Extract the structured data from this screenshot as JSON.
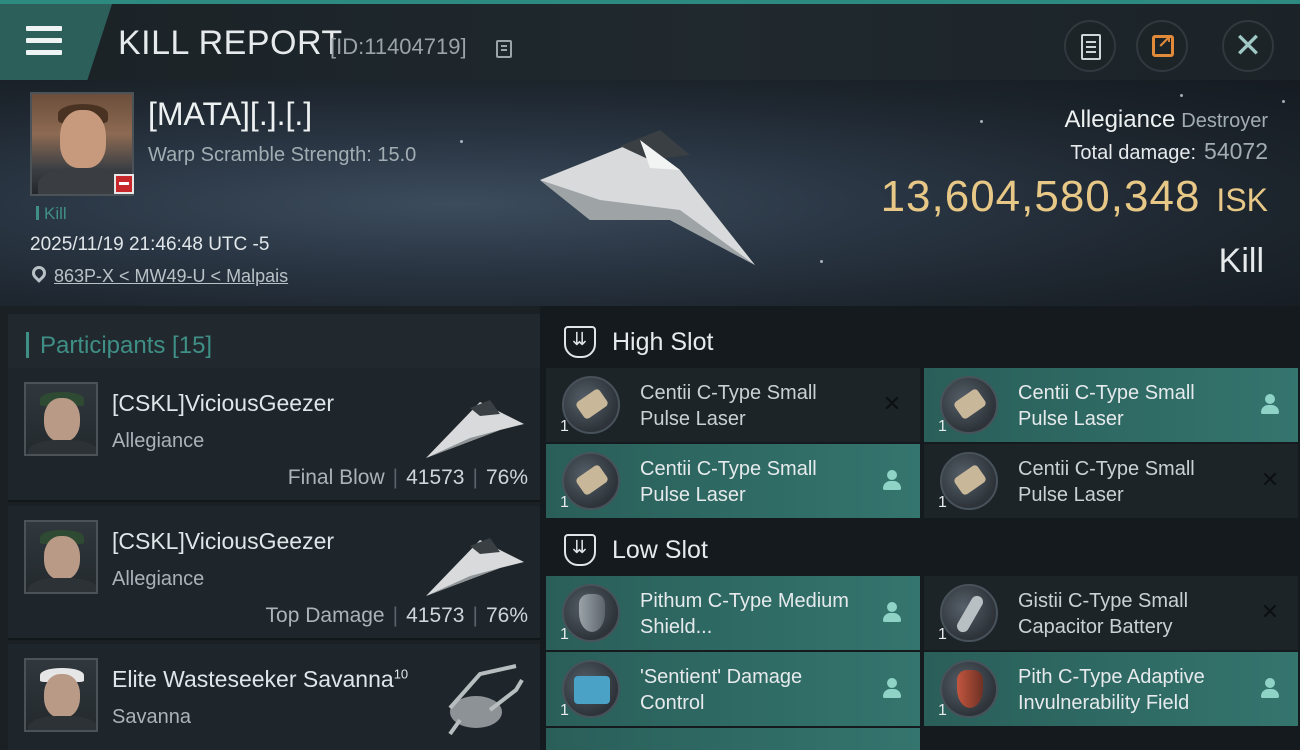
{
  "header": {
    "title": "KILL REPORT",
    "kill_id": "[ID:11404719]"
  },
  "victim": {
    "name": "[MATA][.].[.]",
    "warp_scramble": "Warp Scramble Strength: 15.0",
    "tag": "Kill",
    "datetime": "2025/11/19 21:46:48 UTC -5",
    "location": "863P-X < MW49-U < Malpais",
    "ship_name": "Allegiance",
    "ship_class": "Destroyer",
    "total_damage_label": "Total damage:",
    "total_damage": "54072",
    "isk_value": "13,604,580,348",
    "isk_unit": "ISK",
    "result": "Kill"
  },
  "participants": {
    "label": "Participants [15]",
    "items": [
      {
        "name": "[CSKL]ViciousGeezer",
        "sup": "",
        "corp": "Allegiance",
        "stat_label": "Final Blow",
        "damage": "41573",
        "percent": "76%"
      },
      {
        "name": "[CSKL]ViciousGeezer",
        "sup": "",
        "corp": "Allegiance",
        "stat_label": "Top Damage",
        "damage": "41573",
        "percent": "76%"
      },
      {
        "name": "Elite Wasteseeker Savanna",
        "sup": "10",
        "corp": "Savanna",
        "stat_label": "",
        "damage": "",
        "percent": ""
      }
    ]
  },
  "fitting": {
    "high_slot": {
      "label": "High Slot",
      "modules": [
        {
          "name": "Centii C-Type Small Pulse Laser",
          "qty": "1",
          "status": "destroyed",
          "icon": "laser-icon"
        },
        {
          "name": "Centii C-Type Small Pulse Laser",
          "qty": "1",
          "status": "dropped",
          "icon": "laser-icon"
        },
        {
          "name": "Centii C-Type Small Pulse Laser",
          "qty": "1",
          "status": "dropped",
          "icon": "laser-icon"
        },
        {
          "name": "Centii C-Type Small Pulse Laser",
          "qty": "1",
          "status": "destroyed",
          "icon": "laser-icon"
        }
      ]
    },
    "low_slot": {
      "label": "Low Slot",
      "modules": [
        {
          "name": "Pithum C-Type Medium Shield...",
          "qty": "1",
          "status": "dropped",
          "icon": "shield-icon"
        },
        {
          "name": "Gistii C-Type Small Capacitor Battery",
          "qty": "1",
          "status": "destroyed",
          "icon": "capacitor-icon"
        },
        {
          "name": "'Sentient' Damage Control",
          "qty": "1",
          "status": "dropped",
          "icon": "damage-control-icon"
        },
        {
          "name": "Pith C-Type Adaptive Invulnerability Field",
          "qty": "1",
          "status": "dropped",
          "icon": "invulnerability-field-icon"
        }
      ]
    }
  },
  "colors": {
    "accent_teal": "#3f8f86",
    "isk_gold": "#e8c886",
    "dropped_module_bg": "#34756e",
    "destroyed_module_bg": "#1d2428"
  }
}
